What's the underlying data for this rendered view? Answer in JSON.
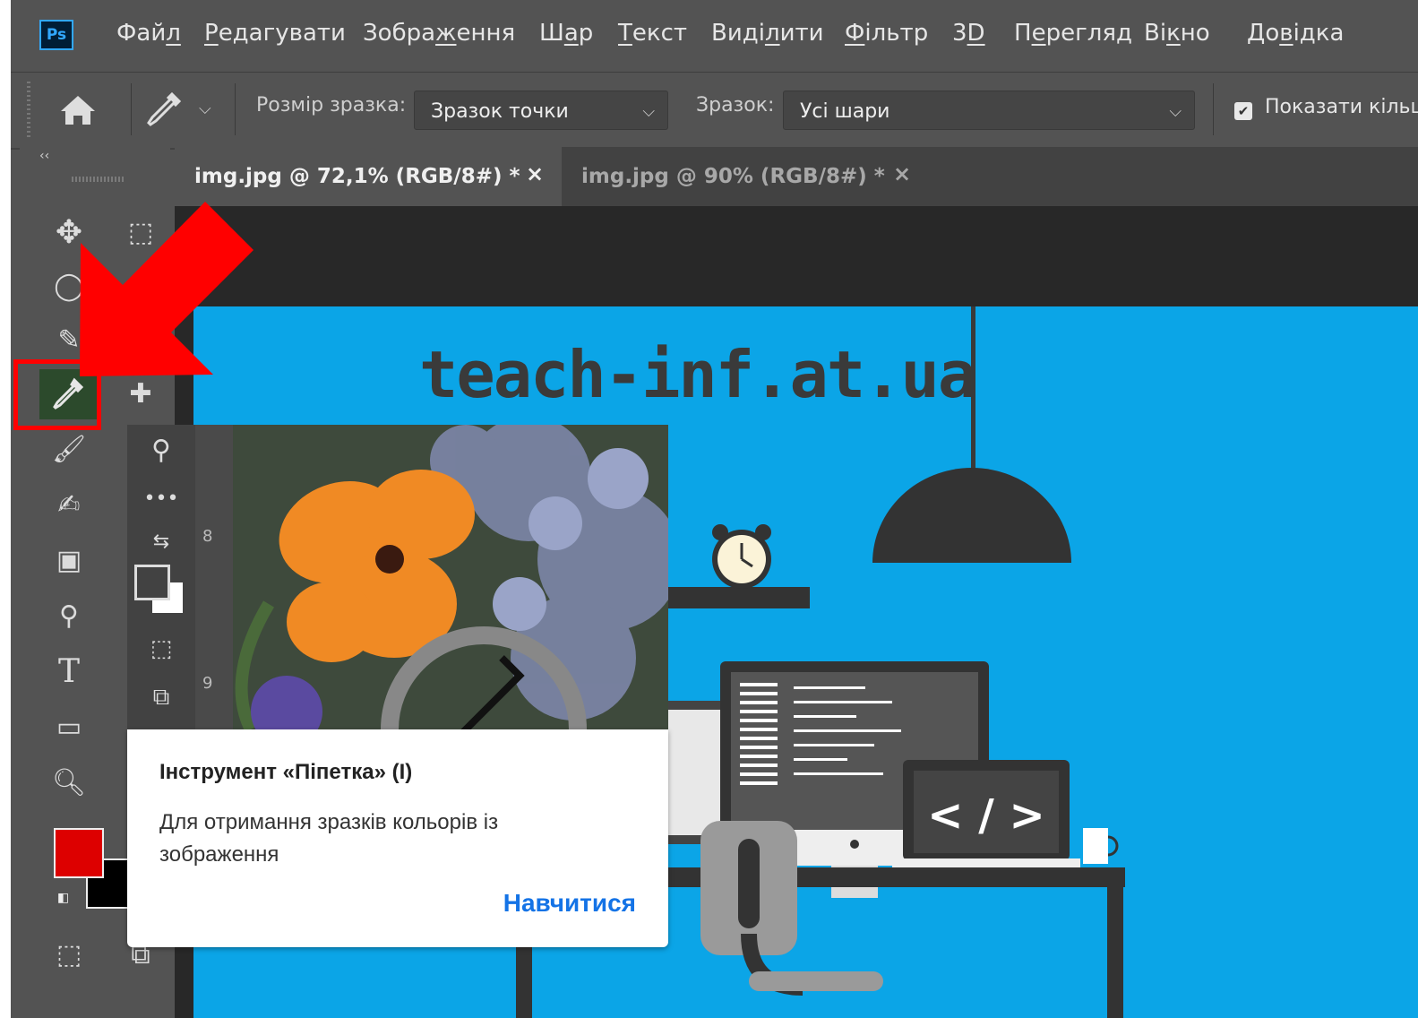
{
  "app": {
    "logo": "Ps"
  },
  "menu": [
    {
      "pre": "Фай",
      "u": "л",
      "post": ""
    },
    {
      "pre": "",
      "u": "Р",
      "post": "едагувати"
    },
    {
      "pre": "Зобра",
      "u": "ж",
      "post": "ення"
    },
    {
      "pre": "Ш",
      "u": "а",
      "post": "р"
    },
    {
      "pre": "",
      "u": "Т",
      "post": "екст"
    },
    {
      "pre": "Виді",
      "u": "л",
      "post": "ити"
    },
    {
      "pre": "",
      "u": "Ф",
      "post": "ільтр"
    },
    {
      "pre": "3",
      "u": "D",
      "post": ""
    },
    {
      "pre": "П",
      "u": "е",
      "post": "регляд"
    },
    {
      "pre": "Ві",
      "u": "к",
      "post": "но"
    },
    {
      "pre": "До",
      "u": "в",
      "post": "ідка"
    }
  ],
  "options": {
    "sample_size_label": "Розмір зразка:",
    "sample_size_value": "Зразок точки",
    "sample_label": "Зразок:",
    "sample_value": "Усі шари",
    "show_ring_label": "Показати кільц",
    "show_ring_checked": true
  },
  "tabs": [
    {
      "label": "img.jpg @ 72,1% (RGB/8#) *",
      "active": true
    },
    {
      "label": "img.jpg @ 90% (RGB/8#) *",
      "active": false
    }
  ],
  "canvas": {
    "site_text": "teach-inf.at.ua"
  },
  "tooltip": {
    "title": "Інструмент «Піпетка» (I)",
    "description": "Для отримання зразків кольорів із зображення",
    "learn_link": "Навчитися",
    "ruler_marks": [
      "8",
      "9"
    ]
  },
  "colors": {
    "foreground": "#dd0000",
    "background": "#000000",
    "canvas_bg": "#0ba5e7",
    "annotation": "#ff0000",
    "active_tool": "#2c4a2c"
  },
  "icons": {
    "close": "×",
    "chevron": "⌵",
    "collapse": "‹‹",
    "check": "✔"
  }
}
